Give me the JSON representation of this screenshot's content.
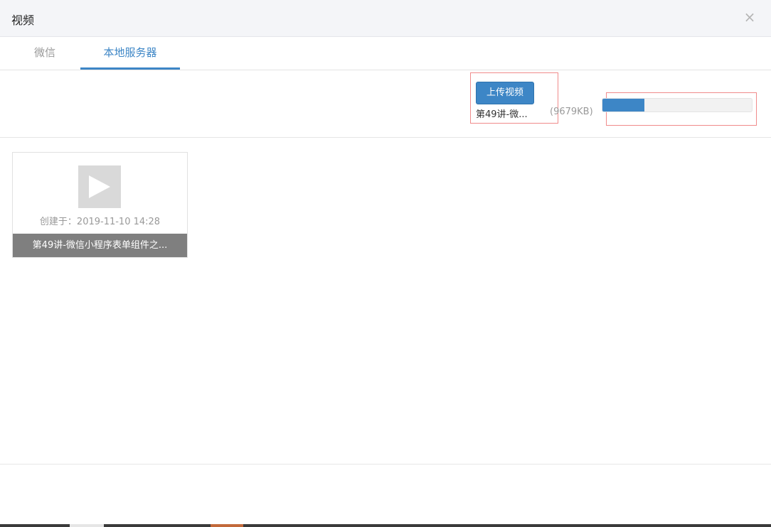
{
  "modal": {
    "title": "视频",
    "close_icon": "×"
  },
  "tabs": [
    {
      "label": "微信",
      "active": false
    },
    {
      "label": "本地服务器",
      "active": true
    }
  ],
  "upload": {
    "button_label": "上传视频",
    "file_name": "第49讲-微...",
    "file_size": "(9679KB)",
    "progress_fraction": 0.28
  },
  "videos": [
    {
      "thumbnail_icon": "play-icon",
      "created": "创建于：2019-11-10 14:28",
      "title": "第49讲-微信小程序表单组件之..."
    }
  ],
  "colors": {
    "accent": "#3d86c6",
    "highlight_box": "#f08b8b",
    "card_title_bg": "#7f7f7f"
  }
}
